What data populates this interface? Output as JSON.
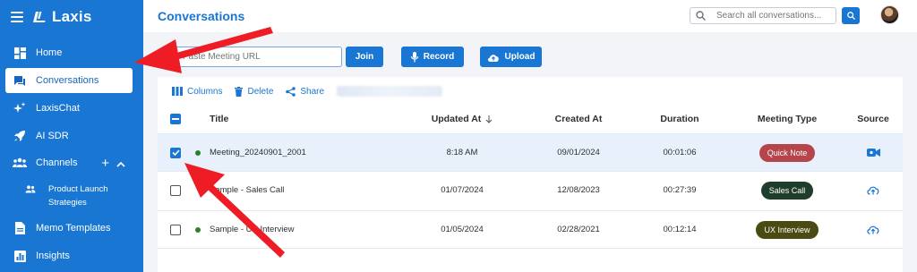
{
  "app": {
    "name": "Laxis"
  },
  "sidebar": {
    "items": [
      {
        "label": "Home",
        "icon": "dashboard-icon"
      },
      {
        "label": "Conversations",
        "icon": "chat-icon",
        "active": true
      },
      {
        "label": "LaxisChat",
        "icon": "sparkle-icon"
      },
      {
        "label": "AI SDR",
        "icon": "rocket-icon"
      },
      {
        "label": "Channels",
        "icon": "group-icon"
      },
      {
        "label": "Memo Templates",
        "icon": "document-icon"
      },
      {
        "label": "Insights",
        "icon": "insights-icon"
      }
    ],
    "channel_item": {
      "label": "Product Launch Strategies",
      "line1": "Product Launch",
      "line2": "Strategies",
      "icon": "people-icon"
    }
  },
  "header": {
    "title": "Conversations",
    "search_placeholder": "Search all conversations..."
  },
  "actions": {
    "url_placeholder": "Paste Meeting URL",
    "join_label": "Join",
    "record_label": "Record",
    "upload_label": "Upload"
  },
  "toolbar": {
    "columns_label": "Columns",
    "delete_label": "Delete",
    "share_label": "Share"
  },
  "table": {
    "columns": [
      "Title",
      "Updated At",
      "Created At",
      "Duration",
      "Meeting Type",
      "Source"
    ],
    "rows": [
      {
        "title": "Meeting_20240901_2001",
        "updated": "8:18 AM",
        "created": "09/01/2024",
        "duration": "00:01:06",
        "type": "Quick Note",
        "type_color": "#b5454b",
        "source_icon": "video-camera-icon",
        "checked": true
      },
      {
        "title": "Sample - Sales Call",
        "updated": "01/07/2024",
        "created": "12/08/2023",
        "duration": "00:27:39",
        "type": "Sales Call",
        "type_color": "#1f3d2b",
        "source_icon": "cloud-upload-icon",
        "checked": false
      },
      {
        "title": "Sample - UX Interview",
        "updated": "01/05/2024",
        "created": "02/28/2021",
        "duration": "00:12:14",
        "type": "UX Interview",
        "type_color": "#4a4a12",
        "source_icon": "cloud-upload-icon",
        "checked": false
      }
    ]
  },
  "colors": {
    "primary": "#1976d2",
    "annotation_arrow": "#ee1c24",
    "status_dot": "#2e7d32"
  }
}
